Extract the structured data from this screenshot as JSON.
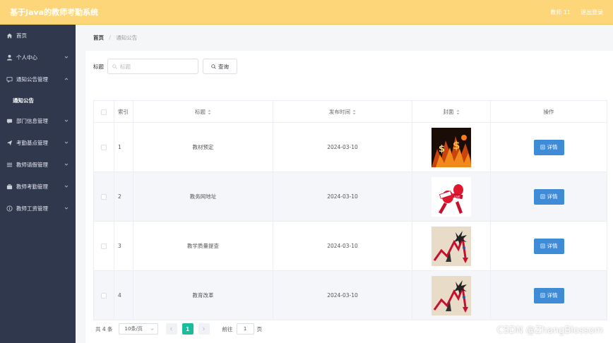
{
  "app": {
    "title": "基于Java的教师考勤系统"
  },
  "header": {
    "user": "教师 11",
    "logout": "退出登录"
  },
  "sidebar": {
    "items": [
      {
        "label": "首页",
        "icon": "home-icon"
      },
      {
        "label": "个人中心",
        "icon": "user-icon"
      },
      {
        "label": "通知公告管理",
        "icon": "message-icon"
      },
      {
        "label": "部门信息管理",
        "icon": "chat-icon"
      },
      {
        "label": "考勤基点管理",
        "icon": "send-icon"
      },
      {
        "label": "教师请假管理",
        "icon": "menu-icon"
      },
      {
        "label": "教师考勤管理",
        "icon": "case-icon"
      },
      {
        "label": "教师工资管理",
        "icon": "info-icon"
      }
    ],
    "sub_item": "通知公告"
  },
  "breadcrumb": {
    "home": "首页",
    "sep": "/",
    "current": "通知公告"
  },
  "search": {
    "label": "标题",
    "placeholder": "标题",
    "button": "查询"
  },
  "table": {
    "columns": {
      "index": "索引",
      "title": "标题",
      "date": "发布时间",
      "cover": "封面",
      "action": "操作"
    },
    "rows": [
      {
        "index": "1",
        "title": "教材预定",
        "date": "2024-03-10",
        "cover": "fire-money-image",
        "action": "详情"
      },
      {
        "index": "2",
        "title": "教务网地址",
        "date": "2024-03-10",
        "cover": "microphone-news-image",
        "action": "详情"
      },
      {
        "index": "3",
        "title": "教学质量提查",
        "date": "2024-03-10",
        "cover": "crashing-chart-image",
        "action": "详情"
      },
      {
        "index": "4",
        "title": "教育改革",
        "date": "2024-03-10",
        "cover": "crashing-chart-image",
        "action": "详情"
      }
    ]
  },
  "pagination": {
    "total": "共 4 条",
    "page_size": "10条/页",
    "current_page": "1",
    "goto_label": "前往",
    "goto_value": "1",
    "page_unit": "页"
  },
  "watermark": "CSDN @ZhangBlossom",
  "colors": {
    "header": "#fed67a",
    "sidebar": "#30384d",
    "button": "#3f8bd6",
    "active_page": "#1abc9c"
  }
}
